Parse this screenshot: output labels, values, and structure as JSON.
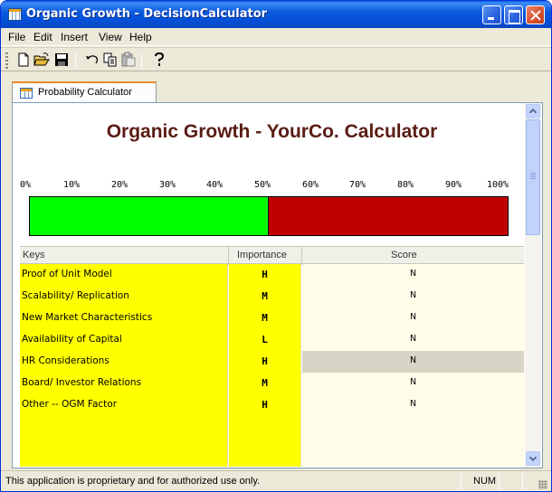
{
  "window": {
    "title": "Organic Growth - DecisionCalculator"
  },
  "menu": [
    "File",
    "Edit",
    "Insert",
    "View",
    "Help"
  ],
  "toolbar": [
    "new-icon",
    "open-icon",
    "save-icon",
    "undo-icon",
    "copy-icon",
    "paste-icon",
    "help-icon"
  ],
  "tab": {
    "label": "Probability Calculator"
  },
  "calculator": {
    "title": "Organic Growth - YourCo. Calculator",
    "scale": [
      "0%",
      "10%",
      "20%",
      "30%",
      "40%",
      "50%",
      "60%",
      "70%",
      "80%",
      "90%",
      "100%"
    ],
    "probability_fraction": 0.5,
    "colors": {
      "positive": "#00ff00",
      "negative": "#c00000",
      "key_cell": "#ffff00",
      "selected_score": "#d8d4c6"
    }
  },
  "grid": {
    "headers": {
      "keys": "Keys",
      "importance": "Importance",
      "score": "Score"
    },
    "rows": [
      {
        "key": "Proof of Unit Model",
        "importance": "H",
        "score": "N"
      },
      {
        "key": "Scalability/ Replication",
        "importance": "M",
        "score": "N"
      },
      {
        "key": "New Market Characteristics",
        "importance": "M",
        "score": "N"
      },
      {
        "key": "Availability of Capital",
        "importance": "L",
        "score": "N"
      },
      {
        "key": "HR Considerations",
        "importance": "H",
        "score": "N"
      },
      {
        "key": "Board/ Investor Relations",
        "importance": "M",
        "score": "N"
      },
      {
        "key": "Other -- OGM Factor",
        "importance": "H",
        "score": "N"
      },
      {
        "key": "",
        "importance": "",
        "score": ""
      },
      {
        "key": "",
        "importance": "",
        "score": ""
      },
      {
        "key": "",
        "importance": "",
        "score": ""
      }
    ]
  },
  "status": {
    "message": "This application is proprietary and for authorized use only.",
    "num": "NUM"
  }
}
